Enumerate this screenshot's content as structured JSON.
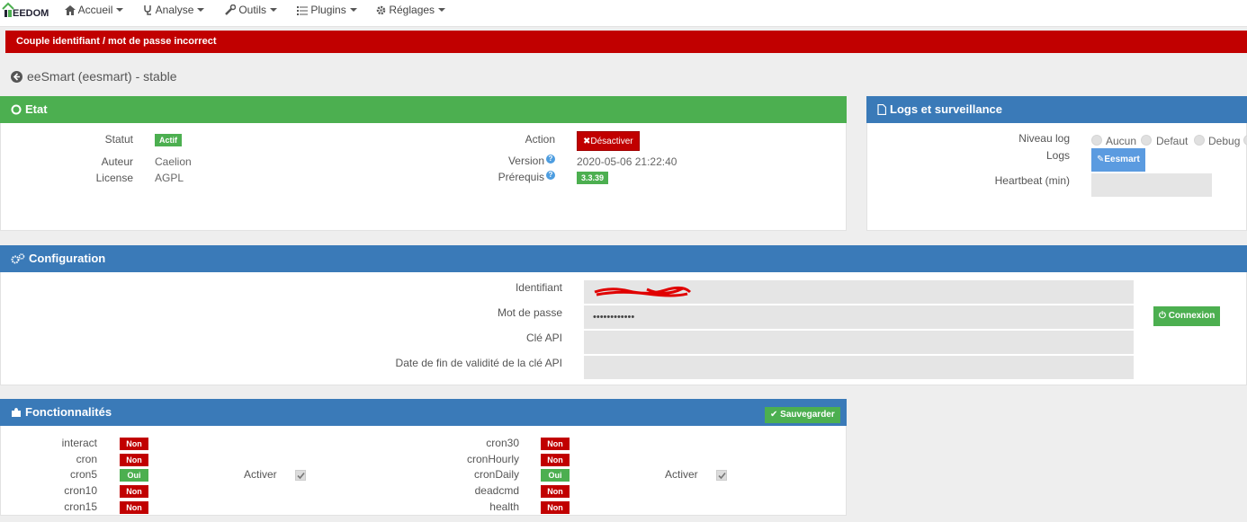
{
  "navbar": {
    "logo_text": "EEDOM",
    "items": [
      {
        "label": "Accueil",
        "icon": "home-icon"
      },
      {
        "label": "Analyse",
        "icon": "stethoscope-icon"
      },
      {
        "label": "Outils",
        "icon": "wrench-icon"
      },
      {
        "label": "Plugins",
        "icon": "tasks-icon"
      },
      {
        "label": "Réglages",
        "icon": "cog-icon"
      }
    ]
  },
  "alert": {
    "message": "Couple identifiant / mot de passe incorrect",
    "color": "#c10000"
  },
  "page": {
    "title": "eeSmart (eesmart) - stable"
  },
  "etat": {
    "heading": "Etat",
    "statut_label": "Statut",
    "statut_value": "Actif",
    "auteur_label": "Auteur",
    "auteur_value": "Caelion",
    "license_label": "License",
    "license_value": "AGPL",
    "action_label": "Action",
    "action_button": "Désactiver",
    "version_label": "Version",
    "version_value": "2020-05-06 21:22:40",
    "prerequis_label": "Prérequis",
    "prerequis_value": "3.3.39",
    "help_glyph": "?"
  },
  "logs": {
    "heading": "Logs et surveillance",
    "niveau_label": "Niveau log",
    "levels": [
      "Aucun",
      "Defaut",
      "Debug"
    ],
    "logs_label": "Logs",
    "logs_button": "Eesmart",
    "heartbeat_label": "Heartbeat (min)",
    "heartbeat_value": ""
  },
  "configuration": {
    "heading": "Configuration",
    "identifiant_label": "Identifiant",
    "identifiant_value": "",
    "password_label": "Mot de passe",
    "password_value": "••••••••••••",
    "api_key_label": "Clé API",
    "api_key_value": "",
    "api_expiry_label": "Date de fin de validité de la clé API",
    "api_expiry_value": "",
    "connect_button": "Connexion"
  },
  "fonctionnalites": {
    "heading": "Fonctionnalités",
    "save_button": "Sauvegarder",
    "activer_label": "Activer",
    "left": [
      {
        "name": "interact",
        "status": "Non"
      },
      {
        "name": "cron",
        "status": "Non"
      },
      {
        "name": "cron5",
        "status": "Oui"
      },
      {
        "name": "cron10",
        "status": "Non"
      },
      {
        "name": "cron15",
        "status": "Non"
      }
    ],
    "right": [
      {
        "name": "cron30",
        "status": "Non"
      },
      {
        "name": "cronHourly",
        "status": "Non"
      },
      {
        "name": "cronDaily",
        "status": "Oui"
      },
      {
        "name": "deadcmd",
        "status": "Non"
      },
      {
        "name": "health",
        "status": "Non"
      }
    ]
  },
  "colors": {
    "green": "#4caf50",
    "blue": "#3a7ab8",
    "red": "#c10000",
    "light_blue": "#5b9be0"
  }
}
